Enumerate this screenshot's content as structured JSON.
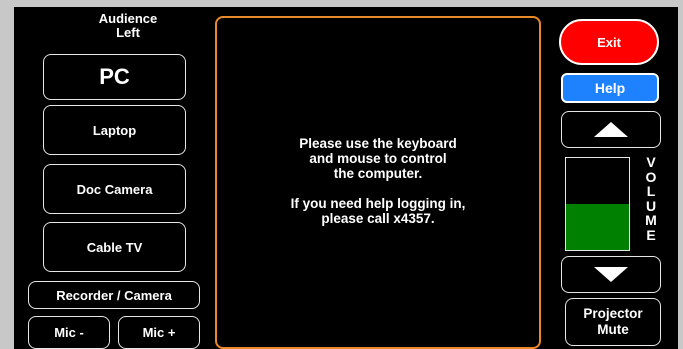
{
  "header": {
    "audience_left": "Audience\nLeft"
  },
  "sources": {
    "pc": "PC",
    "laptop": "Laptop",
    "doc_camera": "Doc Camera",
    "cable_tv": "Cable TV",
    "recorder_camera": "Recorder / Camera"
  },
  "mic": {
    "minus": "Mic -",
    "plus": "Mic +"
  },
  "message": {
    "line1": "Please use the keyboard",
    "line2": "and mouse to control",
    "line3": "the computer.",
    "line4": "If you need help logging in,",
    "line5": "please call x4357."
  },
  "controls": {
    "exit": "Exit",
    "help": "Help",
    "projector_mute": "Projector\nMute"
  },
  "volume": {
    "letters": [
      "V",
      "O",
      "L",
      "U",
      "M",
      "E"
    ],
    "level_percent": 50,
    "up_icon": "triangle-up-icon",
    "down_icon": "triangle-down-icon"
  },
  "colors": {
    "exit": "#ff0000",
    "help": "#1e82ff",
    "volume_fill": "#008000",
    "center_border": "#e88a2a"
  }
}
